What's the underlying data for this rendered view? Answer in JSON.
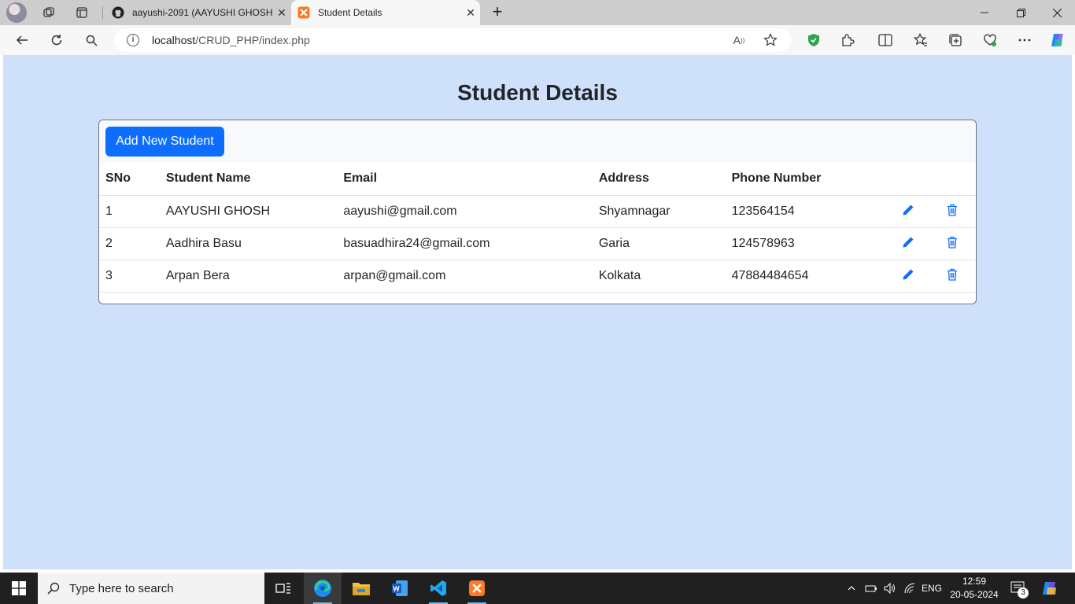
{
  "browser": {
    "tabs": [
      {
        "label": "aayushi-2091 (AAYUSHI GHOSH)",
        "favicon": "github-icon",
        "active": false
      },
      {
        "label": "Student Details",
        "favicon": "xampp-icon",
        "active": true
      }
    ],
    "url_host": "localhost",
    "url_path": "/CRUD_PHP/index.php"
  },
  "page": {
    "title": "Student Details",
    "add_button": "Add New Student",
    "columns": [
      "SNo",
      "Student Name",
      "Email",
      "Address",
      "Phone Number"
    ],
    "rows": [
      {
        "sno": "1",
        "name": "AAYUSHI GHOSH",
        "email": "aayushi@gmail.com",
        "address": "Shyamnagar",
        "phone": "123564154"
      },
      {
        "sno": "2",
        "name": "Aadhira Basu",
        "email": "basuadhira24@gmail.com",
        "address": "Garia",
        "phone": "124578963"
      },
      {
        "sno": "3",
        "name": "Arpan Bera",
        "email": "arpan@gmail.com",
        "address": "Kolkata",
        "phone": "47884484654"
      }
    ],
    "row_actions": [
      "edit-icon",
      "trash-icon"
    ],
    "accent": "#0d6efd",
    "background": "#cfe0fb"
  },
  "taskbar": {
    "search_placeholder": "Type here to search",
    "language": "ENG",
    "time": "12:59",
    "date": "20-05-2024",
    "notification_count": "3"
  }
}
